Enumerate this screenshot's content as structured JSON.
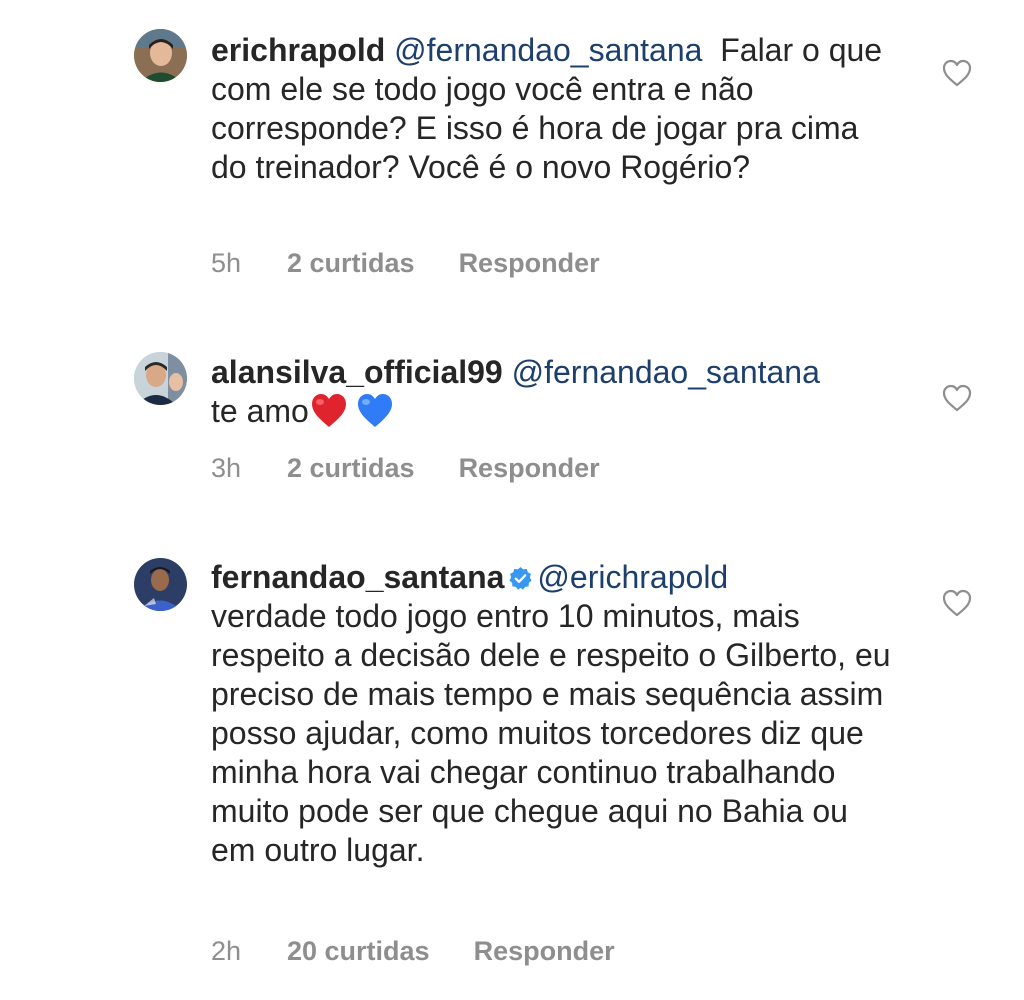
{
  "comments": [
    {
      "username": "erichrapold",
      "mention": "@fernandao_santana",
      "text": "Falar o que com ele se todo jogo você entra e não corresponde? E isso é hora de jogar pra cima do treinador? Você é o novo Rogério?",
      "time": "5h",
      "likes": "2 curtidas",
      "reply": "Responder",
      "verified": false
    },
    {
      "username": "alansilva_official99",
      "mention": "@fernandao_santana",
      "text": "te amo",
      "emojis": [
        "red-heart-emoji",
        "blue-heart-emoji"
      ],
      "time": "3h",
      "likes": "2 curtidas",
      "reply": "Responder",
      "verified": false
    },
    {
      "username": "fernandao_santana",
      "mention": "@erichrapold",
      "text": "verdade todo jogo entro 10 minutos, mais respeito a decisão dele e respeito o Gilberto, eu preciso de mais tempo e mais sequência assim posso ajudar, como muitos torcedores diz que minha hora vai chegar continuo trabalhando muito pode ser que chegue aqui no Bahia ou em outro lugar.",
      "time": "2h",
      "likes": "20 curtidas",
      "reply": "Responder",
      "verified": true
    }
  ],
  "colors": {
    "text": "#262626",
    "mention": "#1d3f6e",
    "meta": "#8e8e8e",
    "verified_badge": "#3897f0",
    "heart_outline": "#8e8e8e"
  },
  "icons": {
    "like": "heart-outline-icon",
    "verified": "verified-badge-icon"
  }
}
